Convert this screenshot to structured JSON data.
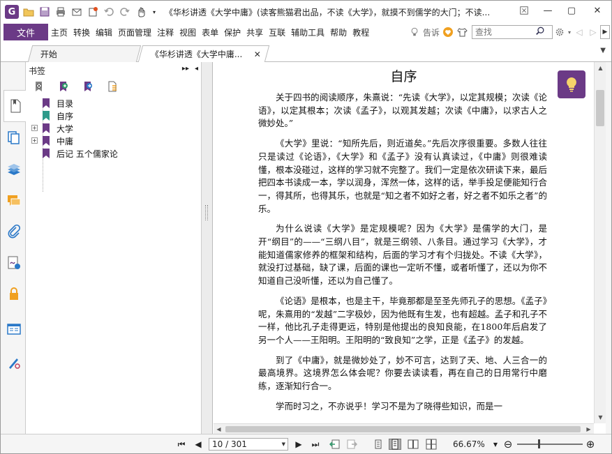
{
  "app": {
    "logo_letter": "G",
    "window_title": "《华杉讲透《大学中庸》(读客熊猫君出品，不读《大学》，就摸不到儒学的大门；不读...",
    "accent_color": "#6b3a86"
  },
  "quick_access": {
    "icons": [
      "open-folder-icon",
      "save-icon",
      "print-icon",
      "email-icon",
      "new-icon",
      "undo-icon",
      "redo-icon",
      "hand-tool-icon",
      "customize-icon"
    ]
  },
  "window_controls": {
    "minimize": "—",
    "maximize": "▢",
    "close": "✕"
  },
  "menubar": {
    "file_label": "文件",
    "items": [
      "主页",
      "转换",
      "编辑",
      "页面管理",
      "注释",
      "视图",
      "表单",
      "保护",
      "共享",
      "互联",
      "辅助工具",
      "帮助",
      "教程"
    ],
    "tell_me_label": "告诉",
    "search_placeholder": "查找"
  },
  "tabs": {
    "start_label": "开始",
    "doc_label": "《华杉讲透《大学中庸...",
    "close_glyph": "✕",
    "menu_glyph": "▼"
  },
  "bookmarks": {
    "header": "书签",
    "expand_glyph": "▸▸",
    "collapse_glyph": "◂",
    "items": [
      {
        "label": "目录",
        "expandable": false,
        "flag_color": "#6b3a86"
      },
      {
        "label": "自序",
        "expandable": false,
        "flag_color": "#2e9a8a"
      },
      {
        "label": "大学",
        "expandable": true,
        "flag_color": "#6b3a86"
      },
      {
        "label": "中庸",
        "expandable": true,
        "flag_color": "#6b3a86"
      },
      {
        "label": "后记 五个儒家论",
        "expandable": false,
        "flag_color": "#6b3a86"
      }
    ]
  },
  "document": {
    "title": "自序",
    "paragraphs": [
      "关于四书的阅读顺序，朱熹说：“先读《大学》，以定其规模；次读《论语》，以定其根本；次读《孟子》，以观其发越；次读《中庸》，以求古人之微妙处。”",
      "《大学》里说：“知所先后，则近道矣。”先后次序很重要。多数人往往只是读过《论语》，《大学》和《孟子》没有认真读过，《中庸》则很难读懂，根本没碰过，这样的学习就不完整了。我们一定是依次研读下来，最后把四本书读成一本，学以润身，浑然一体，这样的话，举手投足便能知行合一，得其所，也得其乐，也就是“知之者不如好之者，好之者不如乐之者”的乐。",
      "为什么说读《大学》是定规模呢？因为《大学》是儒学的大门，是开“纲目”的——“三纲八目”，就是三纲领、八条目。通过学习《大学》，才能知道儒家修养的框架和结构，后面的学习才有个归拢处。不读《大学》，就没打过基础，缺了课，后面的课也一定听不懂，或者听懂了，还以为你不知道自己没听懂，还以为自己懂了。",
      "《论语》是根本，也是主干，毕竟那都是至圣先师孔子的思想。《孟子》呢，朱熹用的“发越”二字极妙，因为他既有生发，也有超越。孟子和孔子不一样，他比孔子走得更远，特别是他提出的良知良能，在1800年后启发了另一个人——王阳明。王阳明的“致良知”之学，正是《孟子》的发越。",
      "到了《中庸》，就是微妙处了，妙不可言，达到了天、地、人三合一的最高境界。这境界怎么体会呢？你要去读读看，再在自己的日用常行中磨练，逐渐知行合一。",
      "学而时习之，不亦说乎！学习不是为了晓得些知识，而是一"
    ]
  },
  "statusbar": {
    "page_indicator": "10 / 301",
    "zoom_level": "66.67%",
    "zoom_out_glyph": "⊖",
    "zoom_in_glyph": "⊕"
  }
}
